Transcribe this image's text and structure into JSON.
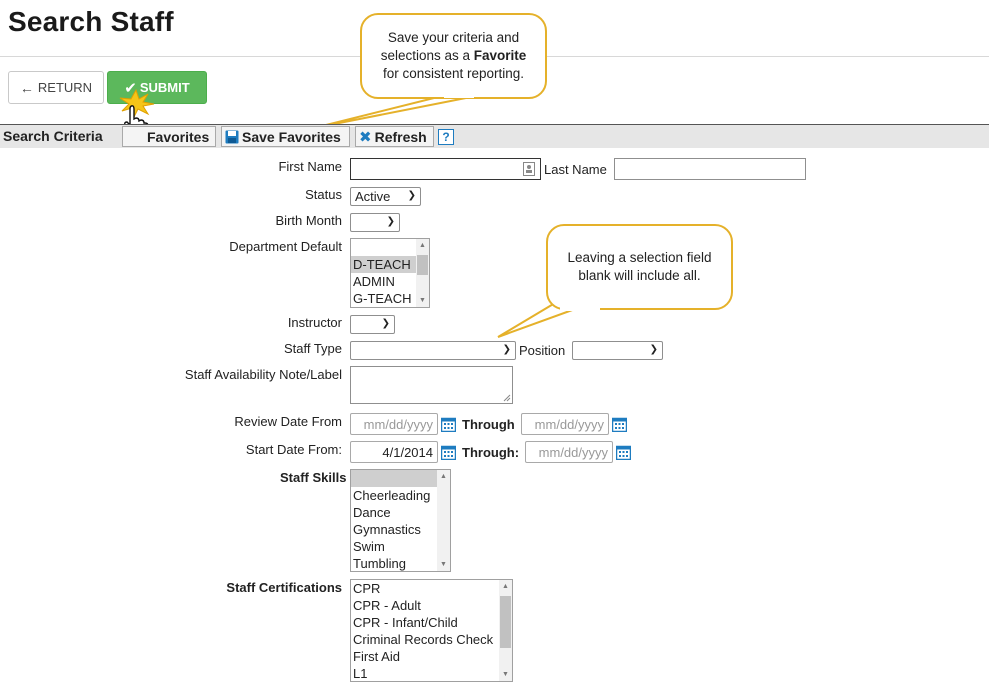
{
  "page": {
    "title": "Search Staff"
  },
  "toolbar": {
    "return_label": "RETURN",
    "submit_label": "SUBMIT"
  },
  "criteria": {
    "label": "Search Criteria",
    "favorites_label": "Favorites",
    "save_favorites_label": "Save Favorites",
    "refresh_label": "Refresh",
    "help_label": "?"
  },
  "callouts": {
    "favorite": {
      "line1": "Save your criteria and",
      "line2_prefix": "selections as a ",
      "line2_bold": "Favorite",
      "line3": "for consistent reporting."
    },
    "blank": {
      "line1": "Leaving a selection field",
      "line2": "blank will include all."
    }
  },
  "form": {
    "first_name": {
      "label": "First Name",
      "value": ""
    },
    "last_name": {
      "label": "Last Name",
      "value": ""
    },
    "status": {
      "label": "Status",
      "value": "Active"
    },
    "birth_month": {
      "label": "Birth Month",
      "value": ""
    },
    "department_default": {
      "label": "Department Default",
      "options": [
        "",
        "D-TEACH",
        "ADMIN",
        "G-TEACH"
      ]
    },
    "instructor": {
      "label": "Instructor",
      "value": ""
    },
    "staff_type": {
      "label": "Staff Type",
      "value": ""
    },
    "position": {
      "label": "Position",
      "value": ""
    },
    "availability_note": {
      "label": "Staff Availability Note/Label",
      "value": ""
    },
    "review_date_from": {
      "label": "Review Date From",
      "placeholder": "mm/dd/yyyy"
    },
    "review_through": {
      "label": "Through",
      "placeholder": "mm/dd/yyyy"
    },
    "start_date_from": {
      "label": "Start Date From:",
      "value": "4/1/2014"
    },
    "start_through": {
      "label": "Through:",
      "placeholder": "mm/dd/yyyy"
    },
    "staff_skills": {
      "label": "Staff Skills",
      "options": [
        "",
        "Cheerleading",
        "Dance",
        "Gymnastics",
        "Swim",
        "Tumbling"
      ]
    },
    "staff_certifications": {
      "label": "Staff Certifications",
      "options": [
        "CPR",
        "CPR - Adult",
        "CPR - Infant/Child",
        "Criminal Records Check",
        "First Aid",
        "L1"
      ]
    }
  },
  "icons": {
    "return": "arrow-left-icon",
    "submit": "check-icon",
    "save": "floppy-disk-icon",
    "refresh": "x-icon",
    "calendar": "calendar-icon",
    "contact_card": "contact-card-icon"
  },
  "colors": {
    "submit_green": "#5cb85c",
    "callout_border": "#e5b12a",
    "link_blue": "#1e7cc0"
  }
}
